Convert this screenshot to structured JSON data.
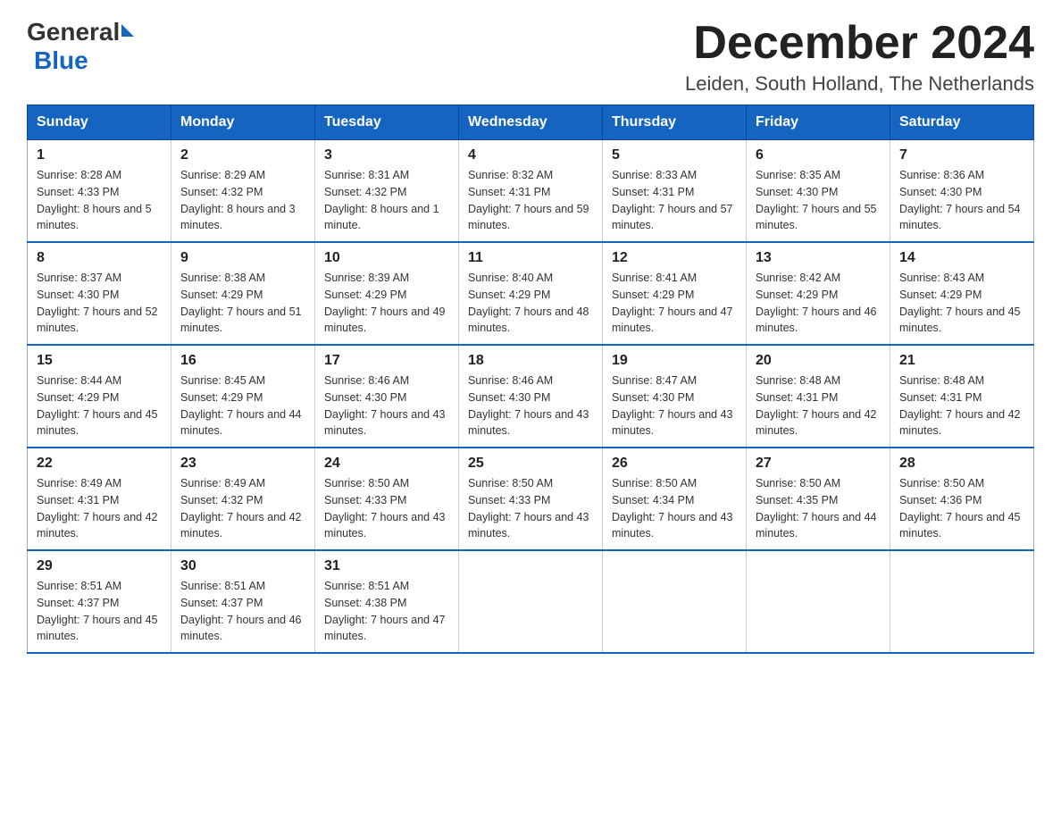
{
  "logo": {
    "general": "General",
    "blue": "Blue"
  },
  "title": "December 2024",
  "subtitle": "Leiden, South Holland, The Netherlands",
  "weekdays": [
    "Sunday",
    "Monday",
    "Tuesday",
    "Wednesday",
    "Thursday",
    "Friday",
    "Saturday"
  ],
  "weeks": [
    [
      {
        "day": "1",
        "sunrise": "8:28 AM",
        "sunset": "4:33 PM",
        "daylight": "8 hours and 5 minutes."
      },
      {
        "day": "2",
        "sunrise": "8:29 AM",
        "sunset": "4:32 PM",
        "daylight": "8 hours and 3 minutes."
      },
      {
        "day": "3",
        "sunrise": "8:31 AM",
        "sunset": "4:32 PM",
        "daylight": "8 hours and 1 minute."
      },
      {
        "day": "4",
        "sunrise": "8:32 AM",
        "sunset": "4:31 PM",
        "daylight": "7 hours and 59 minutes."
      },
      {
        "day": "5",
        "sunrise": "8:33 AM",
        "sunset": "4:31 PM",
        "daylight": "7 hours and 57 minutes."
      },
      {
        "day": "6",
        "sunrise": "8:35 AM",
        "sunset": "4:30 PM",
        "daylight": "7 hours and 55 minutes."
      },
      {
        "day": "7",
        "sunrise": "8:36 AM",
        "sunset": "4:30 PM",
        "daylight": "7 hours and 54 minutes."
      }
    ],
    [
      {
        "day": "8",
        "sunrise": "8:37 AM",
        "sunset": "4:30 PM",
        "daylight": "7 hours and 52 minutes."
      },
      {
        "day": "9",
        "sunrise": "8:38 AM",
        "sunset": "4:29 PM",
        "daylight": "7 hours and 51 minutes."
      },
      {
        "day": "10",
        "sunrise": "8:39 AM",
        "sunset": "4:29 PM",
        "daylight": "7 hours and 49 minutes."
      },
      {
        "day": "11",
        "sunrise": "8:40 AM",
        "sunset": "4:29 PM",
        "daylight": "7 hours and 48 minutes."
      },
      {
        "day": "12",
        "sunrise": "8:41 AM",
        "sunset": "4:29 PM",
        "daylight": "7 hours and 47 minutes."
      },
      {
        "day": "13",
        "sunrise": "8:42 AM",
        "sunset": "4:29 PM",
        "daylight": "7 hours and 46 minutes."
      },
      {
        "day": "14",
        "sunrise": "8:43 AM",
        "sunset": "4:29 PM",
        "daylight": "7 hours and 45 minutes."
      }
    ],
    [
      {
        "day": "15",
        "sunrise": "8:44 AM",
        "sunset": "4:29 PM",
        "daylight": "7 hours and 45 minutes."
      },
      {
        "day": "16",
        "sunrise": "8:45 AM",
        "sunset": "4:29 PM",
        "daylight": "7 hours and 44 minutes."
      },
      {
        "day": "17",
        "sunrise": "8:46 AM",
        "sunset": "4:30 PM",
        "daylight": "7 hours and 43 minutes."
      },
      {
        "day": "18",
        "sunrise": "8:46 AM",
        "sunset": "4:30 PM",
        "daylight": "7 hours and 43 minutes."
      },
      {
        "day": "19",
        "sunrise": "8:47 AM",
        "sunset": "4:30 PM",
        "daylight": "7 hours and 43 minutes."
      },
      {
        "day": "20",
        "sunrise": "8:48 AM",
        "sunset": "4:31 PM",
        "daylight": "7 hours and 42 minutes."
      },
      {
        "day": "21",
        "sunrise": "8:48 AM",
        "sunset": "4:31 PM",
        "daylight": "7 hours and 42 minutes."
      }
    ],
    [
      {
        "day": "22",
        "sunrise": "8:49 AM",
        "sunset": "4:31 PM",
        "daylight": "7 hours and 42 minutes."
      },
      {
        "day": "23",
        "sunrise": "8:49 AM",
        "sunset": "4:32 PM",
        "daylight": "7 hours and 42 minutes."
      },
      {
        "day": "24",
        "sunrise": "8:50 AM",
        "sunset": "4:33 PM",
        "daylight": "7 hours and 43 minutes."
      },
      {
        "day": "25",
        "sunrise": "8:50 AM",
        "sunset": "4:33 PM",
        "daylight": "7 hours and 43 minutes."
      },
      {
        "day": "26",
        "sunrise": "8:50 AM",
        "sunset": "4:34 PM",
        "daylight": "7 hours and 43 minutes."
      },
      {
        "day": "27",
        "sunrise": "8:50 AM",
        "sunset": "4:35 PM",
        "daylight": "7 hours and 44 minutes."
      },
      {
        "day": "28",
        "sunrise": "8:50 AM",
        "sunset": "4:36 PM",
        "daylight": "7 hours and 45 minutes."
      }
    ],
    [
      {
        "day": "29",
        "sunrise": "8:51 AM",
        "sunset": "4:37 PM",
        "daylight": "7 hours and 45 minutes."
      },
      {
        "day": "30",
        "sunrise": "8:51 AM",
        "sunset": "4:37 PM",
        "daylight": "7 hours and 46 minutes."
      },
      {
        "day": "31",
        "sunrise": "8:51 AM",
        "sunset": "4:38 PM",
        "daylight": "7 hours and 47 minutes."
      },
      null,
      null,
      null,
      null
    ]
  ]
}
